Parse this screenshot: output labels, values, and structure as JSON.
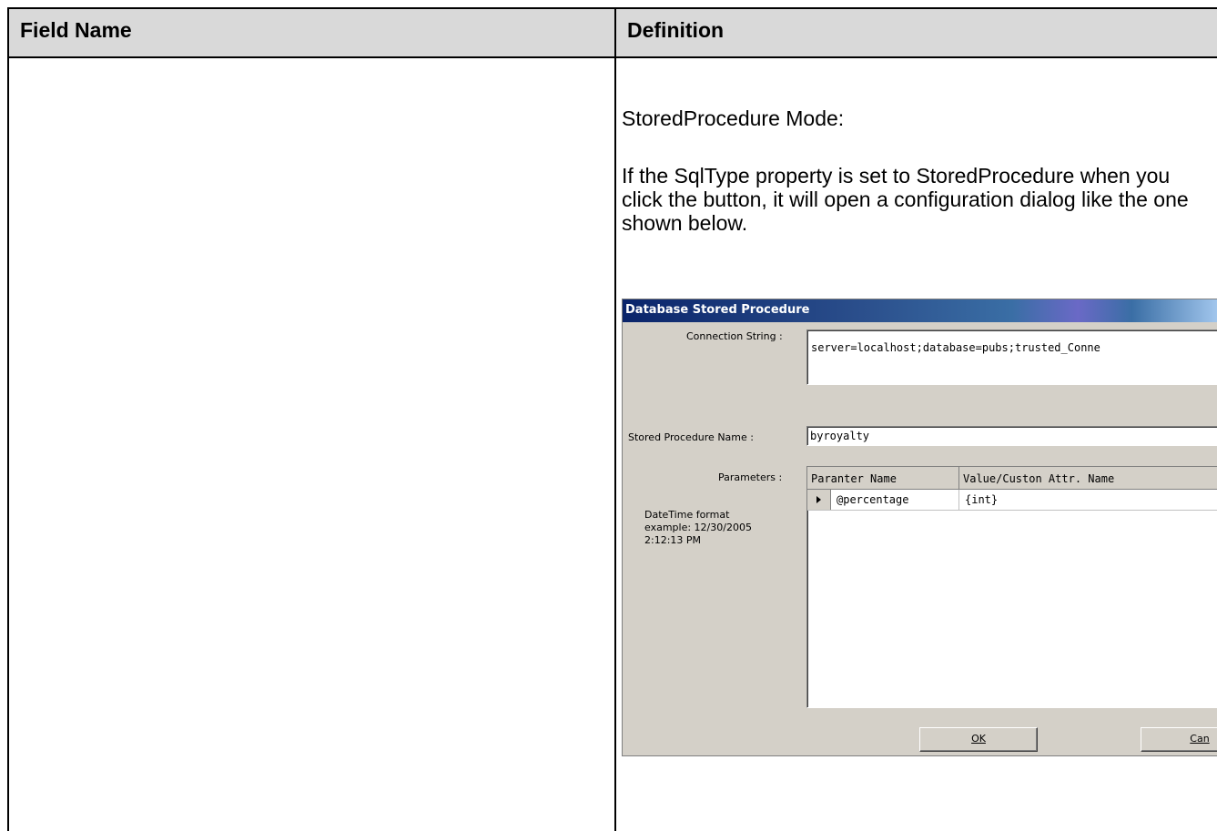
{
  "table": {
    "headers": {
      "field_name": "Field Name",
      "definition": "Definition"
    }
  },
  "definition": {
    "mode_heading": "StoredProcedure Mode:",
    "description": "If the SqlType property is set to StoredProcedure when you click the button, it will open a configuration dialog like the one shown below."
  },
  "dialog": {
    "title": "Database Stored Procedure",
    "connection_label": "Connection String :",
    "connection_value": "server=localhost;database=pubs;trusted_Conne",
    "sp_name_label": "Stored Procedure Name :",
    "sp_name_value": "byroyalty",
    "parameters_label": "Parameters :",
    "grid_headers": [
      "Paranter Name",
      "Value/Custon Attr. Name"
    ],
    "grid_rows": [
      {
        "name": "@percentage",
        "value": "{int}"
      }
    ],
    "datetime_note": "DateTime format example: 12/30/2005 2:12:13 PM",
    "ok_label": "OK",
    "cancel_label": "Can"
  }
}
